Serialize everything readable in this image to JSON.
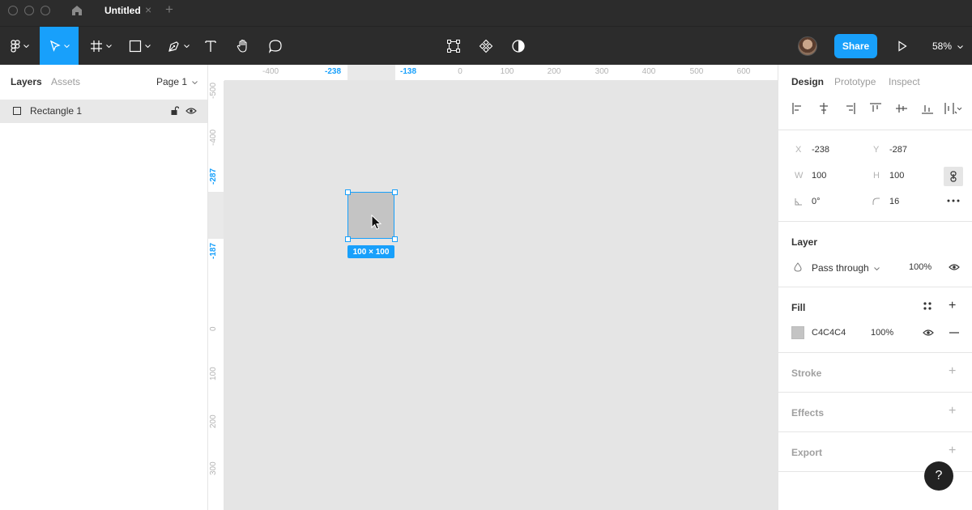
{
  "titlebar": {
    "tab_label": "Untitled",
    "tab_close": "×",
    "tab_add": "+"
  },
  "toolbar": {
    "share_label": "Share",
    "zoom": "58%"
  },
  "left_panel": {
    "tabs": [
      "Layers",
      "Assets"
    ],
    "page_selector": "Page 1",
    "layers": [
      {
        "name": "Rectangle 1"
      }
    ]
  },
  "rulers": {
    "top": [
      {
        "label": "-400",
        "hi": false
      },
      {
        "label": "-238",
        "hi": true
      },
      {
        "label": "-138",
        "hi": true
      },
      {
        "label": "0",
        "hi": false
      },
      {
        "label": "100",
        "hi": false
      },
      {
        "label": "200",
        "hi": false
      },
      {
        "label": "300",
        "hi": false
      },
      {
        "label": "400",
        "hi": false
      },
      {
        "label": "500",
        "hi": false
      },
      {
        "label": "600",
        "hi": false
      }
    ],
    "left": [
      {
        "label": "-500",
        "hi": false
      },
      {
        "label": "-400",
        "hi": false
      },
      {
        "label": "-287",
        "hi": true
      },
      {
        "label": "-187",
        "hi": true
      },
      {
        "label": "0",
        "hi": false
      },
      {
        "label": "100",
        "hi": false
      },
      {
        "label": "200",
        "hi": false
      },
      {
        "label": "300",
        "hi": false
      }
    ]
  },
  "canvas": {
    "selection_size": "100 × 100",
    "fill_color": "#c4c4c4",
    "selection_color": "#18a0fb"
  },
  "right_panel": {
    "tabs": [
      "Design",
      "Prototype",
      "Inspect"
    ],
    "x_label": "X",
    "x_value": "-238",
    "y_label": "Y",
    "y_value": "-287",
    "w_label": "W",
    "w_value": "100",
    "h_label": "H",
    "h_value": "100",
    "rotation_value": "0°",
    "radius_value": "16",
    "layer_title": "Layer",
    "blend_mode": "Pass through",
    "layer_opacity": "100%",
    "fill_title": "Fill",
    "fill_hex": "C4C4C4",
    "fill_opacity": "100%",
    "stroke_title": "Stroke",
    "effects_title": "Effects",
    "export_title": "Export"
  },
  "help_label": "?"
}
